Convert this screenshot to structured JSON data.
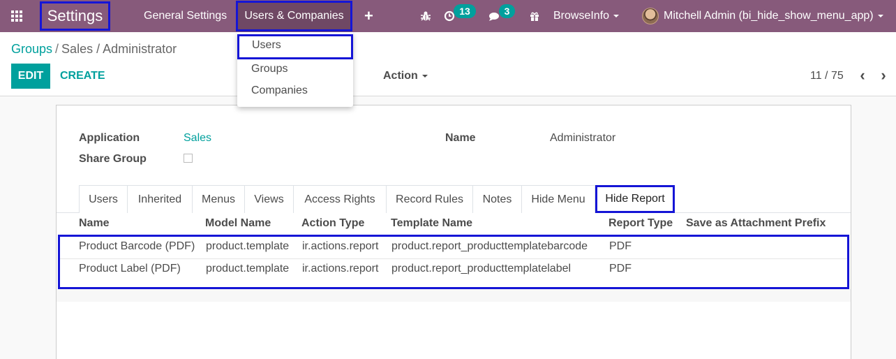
{
  "navbar": {
    "brand": "Settings",
    "menus": [
      "General Settings",
      "Users & Companies"
    ],
    "plus": "+",
    "activity_count": "13",
    "message_count": "3",
    "company": "BrowseInfo",
    "user": "Mitchell Admin (bi_hide_show_menu_app)",
    "accent_color": "#875a7b"
  },
  "dropdown": {
    "items": [
      "Users",
      "Groups",
      "Companies"
    ]
  },
  "breadcrumb": {
    "parent": "Groups",
    "current": "Sales / Administrator"
  },
  "buttons": {
    "edit": "EDIT",
    "create": "CREATE",
    "action": "Action"
  },
  "pager": {
    "value": "11 / 75"
  },
  "form": {
    "application_label": "Application",
    "application_value": "Sales",
    "share_label": "Share Group",
    "share_checked": false,
    "name_label": "Name",
    "name_value": "Administrator"
  },
  "tabs": [
    "Users",
    "Inherited",
    "Menus",
    "Views",
    "Access Rights",
    "Record Rules",
    "Notes",
    "Hide Menu",
    "Hide Report"
  ],
  "active_tab": "Hide Report",
  "table": {
    "columns": [
      "Name",
      "Model Name",
      "Action Type",
      "Template Name",
      "Report Type",
      "Save as Attachment Prefix"
    ],
    "rows": [
      [
        "Product Barcode (PDF)",
        "product.template",
        "ir.actions.report",
        "product.report_producttemplatebarcode",
        "PDF",
        ""
      ],
      [
        "Product Label (PDF)",
        "product.template",
        "ir.actions.report",
        "product.report_producttemplatelabel",
        "PDF",
        ""
      ]
    ]
  },
  "highlight_color": "#1515d6",
  "link_color": "#00a09d"
}
